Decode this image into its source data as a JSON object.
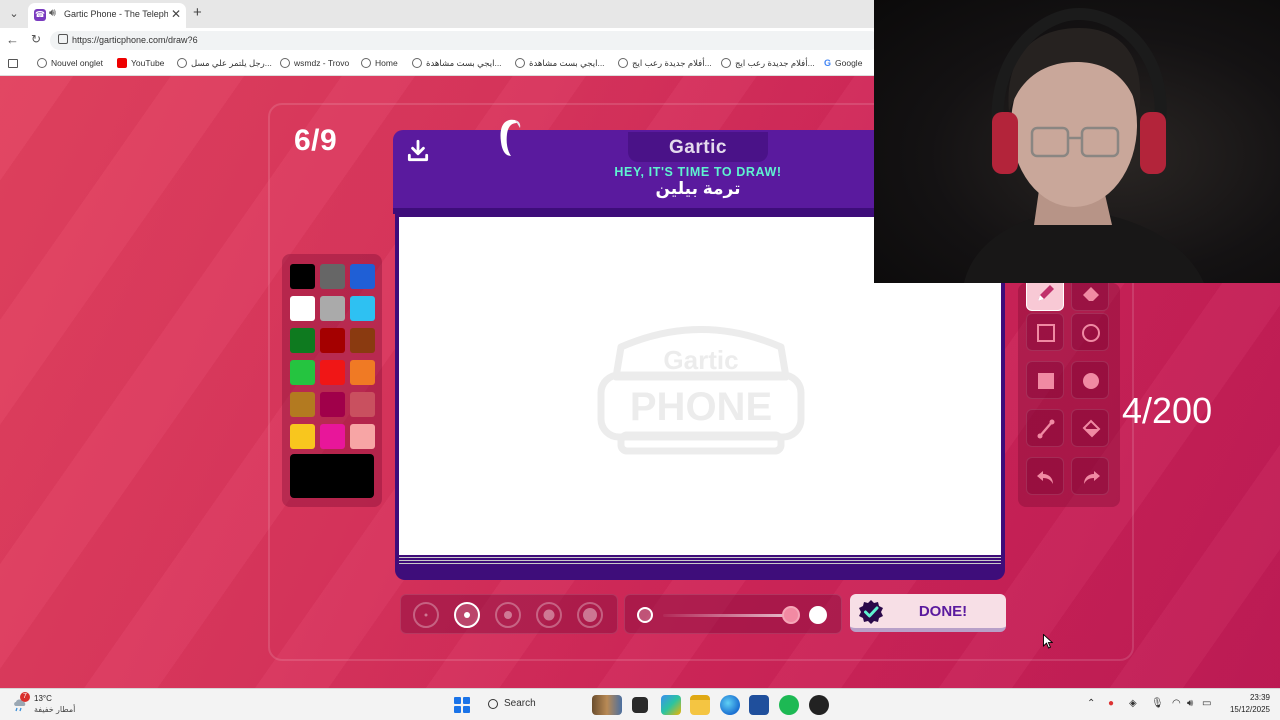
{
  "browser": {
    "tab_title": "Gartic Phone - The Telephone",
    "url": "https://garticphone.com/draw?6",
    "bookmarks": [
      {
        "label": "Nouvel onglet",
        "icon": "globe-icon"
      },
      {
        "label": "YouTube",
        "icon": "youtube-icon"
      },
      {
        "label": "رجل يلتمر علي مسل...",
        "icon": "globe-icon"
      },
      {
        "label": "wsmdz - Trovo",
        "icon": "globe-icon"
      },
      {
        "label": "Home",
        "icon": "globe-icon"
      },
      {
        "label": "ايجي بست مشاهدة...",
        "icon": "globe-icon"
      },
      {
        "label": "ايجي بست مشاهدة...",
        "icon": "globe-icon"
      },
      {
        "label": "أفلام جديدة رعب ايج...",
        "icon": "globe-icon"
      },
      {
        "label": "أفلام جديدة رعب ايج...",
        "icon": "globe-icon"
      },
      {
        "label": "Google",
        "icon": "google-icon"
      }
    ]
  },
  "game": {
    "round": "6/9",
    "logo": "Gartic",
    "instruction": "HEY, IT'S TIME TO DRAW!",
    "prompt": "ترمة بيلين",
    "done_label": "DONE!",
    "selected_brush_size_index": 1,
    "opacity_fraction": 0.97,
    "palette": [
      "#000000",
      "#666666",
      "#1f5fd6",
      "#ffffff",
      "#aaaaaa",
      "#2ec1f2",
      "#0e7a1f",
      "#a40000",
      "#8a3a10",
      "#25c440",
      "#f01616",
      "#f07a24",
      "#b37a20",
      "#a0004a",
      "#c9505f",
      "#f8c61e",
      "#e8169a",
      "#f7a5a5"
    ],
    "selected_color": "#000000",
    "tools": [
      "pen-icon",
      "eraser-icon",
      "rectangle-icon",
      "ellipse-icon",
      "filled-rectangle-icon",
      "filled-ellipse-icon",
      "line-icon",
      "fill-bucket-icon",
      "undo-icon",
      "redo-icon"
    ]
  },
  "stream_overlay": {
    "counter": "4/200"
  },
  "taskbar": {
    "weather_temp": "13°C",
    "weather_desc": "أمطار خفيفة",
    "weather_badge": "7",
    "search_label": "Search",
    "time": "23:39",
    "date": "15/12/2025"
  }
}
